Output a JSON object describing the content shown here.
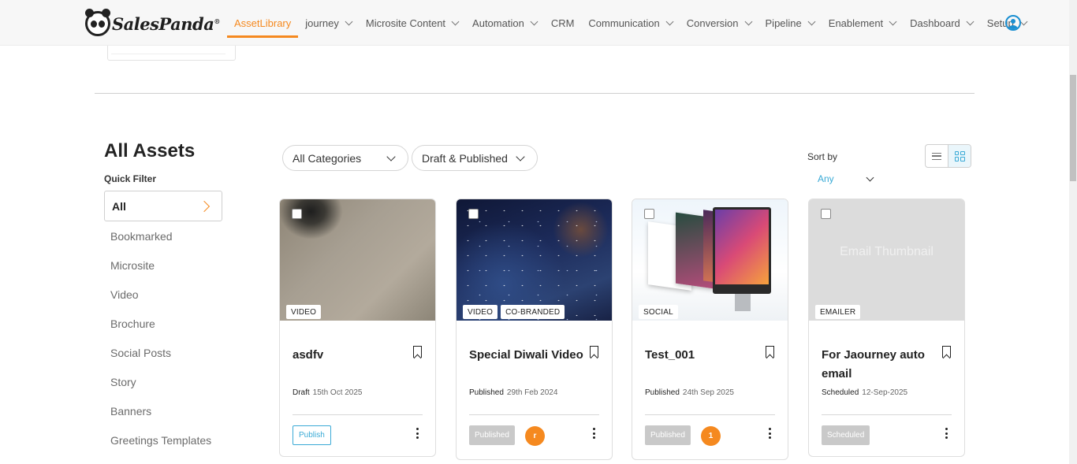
{
  "brand": {
    "name": "SalesPanda",
    "mark": "®"
  },
  "nav": [
    {
      "label": "AssetLibrary",
      "active": true,
      "has_dropdown": false
    },
    {
      "label": "journey",
      "has_dropdown": true
    },
    {
      "label": "Microsite Content",
      "has_dropdown": true
    },
    {
      "label": "Automation",
      "has_dropdown": true
    },
    {
      "label": "CRM",
      "has_dropdown": false
    },
    {
      "label": "Communication",
      "has_dropdown": true
    },
    {
      "label": "Conversion",
      "has_dropdown": true
    },
    {
      "label": "Pipeline",
      "has_dropdown": true
    },
    {
      "label": "Enablement",
      "has_dropdown": true
    },
    {
      "label": "Dashboard",
      "has_dropdown": true
    },
    {
      "label": "Setup",
      "has_dropdown": true
    }
  ],
  "page": {
    "heading": "All Assets"
  },
  "quick_filter": {
    "label": "Quick Filter",
    "selected": "All",
    "items": [
      "Bookmarked",
      "Microsite",
      "Video",
      "Brochure",
      "Social Posts",
      "Story",
      "Banners",
      "Greetings Templates"
    ]
  },
  "filters": {
    "category": "All Categories",
    "status": "Draft & Published"
  },
  "sort": {
    "label": "Sort by",
    "value": "Any"
  },
  "cards": [
    {
      "tags": [
        "VIDEO"
      ],
      "title": "asdfv",
      "status": "Draft",
      "date": "15th Oct 2025",
      "action": "Publish",
      "avatar": ""
    },
    {
      "tags": [
        "VIDEO",
        "CO-BRANDED"
      ],
      "title": "Special Diwali Video",
      "status": "Published",
      "date": "29th Feb 2024",
      "action": "Published",
      "avatar": "r"
    },
    {
      "tags": [
        "SOCIAL"
      ],
      "title": "Test_001",
      "status": "Published",
      "date": "24th Sep 2025",
      "action": "Published",
      "avatar": "1"
    },
    {
      "tags": [
        "EMAILER"
      ],
      "title": "For Jaourney auto email",
      "status": "Scheduled",
      "date": "12-Sep-2025",
      "action": "Scheduled",
      "avatar": "",
      "thumb_text": "Email Thumbnail"
    }
  ],
  "colors": {
    "accent": "#f5891f",
    "link": "#3aaad6",
    "user": "#1a8fd1"
  }
}
